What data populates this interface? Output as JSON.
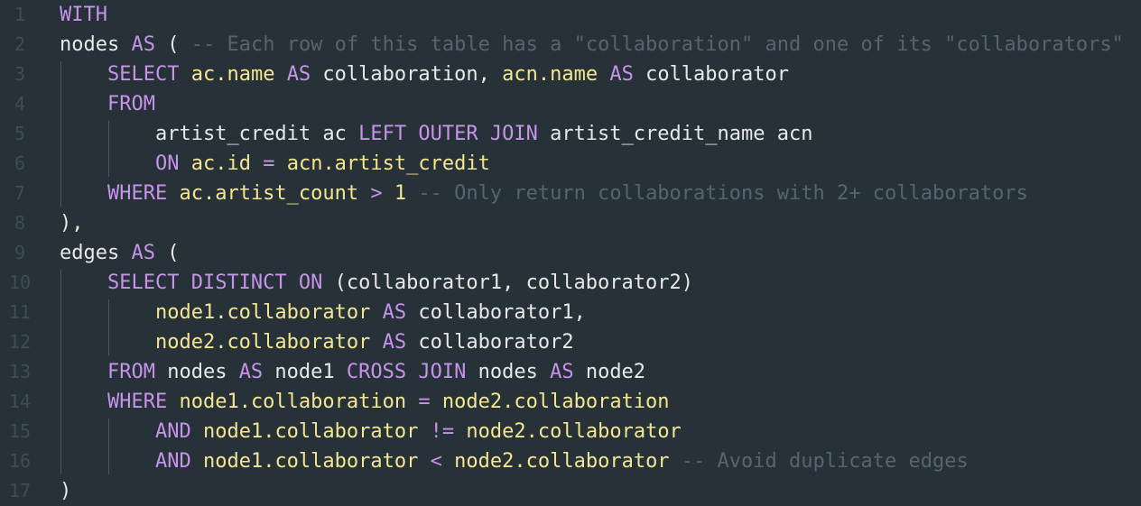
{
  "colors": {
    "background": "#263238",
    "keyword": "#c792ea",
    "identifier": "#f5e592",
    "plain": "#e8e8e8",
    "comment": "#55656f",
    "line_number": "#3f4d55"
  },
  "lines": [
    {
      "number": "1",
      "tokens": [
        {
          "t": "kw",
          "v": "WITH"
        }
      ]
    },
    {
      "number": "2",
      "tokens": [
        {
          "t": "pl",
          "v": "nodes "
        },
        {
          "t": "kw",
          "v": "AS"
        },
        {
          "t": "pl",
          "v": " ( "
        },
        {
          "t": "cm",
          "v": "-- Each row of this table has a \"collaboration\" and one of its \"collaborators\""
        }
      ]
    },
    {
      "number": "3",
      "tokens": [
        {
          "t": "pl",
          "v": "    "
        },
        {
          "t": "kw",
          "v": "SELECT"
        },
        {
          "t": "pl",
          "v": " "
        },
        {
          "t": "id",
          "v": "ac.name"
        },
        {
          "t": "pl",
          "v": " "
        },
        {
          "t": "kw",
          "v": "AS"
        },
        {
          "t": "pl",
          "v": " collaboration, "
        },
        {
          "t": "id",
          "v": "acn.name"
        },
        {
          "t": "pl",
          "v": " "
        },
        {
          "t": "kw",
          "v": "AS"
        },
        {
          "t": "pl",
          "v": " collaborator"
        }
      ]
    },
    {
      "number": "4",
      "tokens": [
        {
          "t": "pl",
          "v": "    "
        },
        {
          "t": "kw",
          "v": "FROM"
        }
      ]
    },
    {
      "number": "5",
      "tokens": [
        {
          "t": "pl",
          "v": "        artist_credit ac "
        },
        {
          "t": "kw",
          "v": "LEFT OUTER JOIN"
        },
        {
          "t": "pl",
          "v": " artist_credit_name acn"
        }
      ]
    },
    {
      "number": "6",
      "tokens": [
        {
          "t": "pl",
          "v": "        "
        },
        {
          "t": "kw",
          "v": "ON"
        },
        {
          "t": "pl",
          "v": " "
        },
        {
          "t": "id",
          "v": "ac.id"
        },
        {
          "t": "pl",
          "v": " "
        },
        {
          "t": "op",
          "v": "="
        },
        {
          "t": "pl",
          "v": " "
        },
        {
          "t": "id",
          "v": "acn.artist_credit"
        }
      ]
    },
    {
      "number": "7",
      "tokens": [
        {
          "t": "pl",
          "v": "    "
        },
        {
          "t": "kw",
          "v": "WHERE"
        },
        {
          "t": "pl",
          "v": " "
        },
        {
          "t": "id",
          "v": "ac.artist_count"
        },
        {
          "t": "pl",
          "v": " "
        },
        {
          "t": "op",
          "v": ">"
        },
        {
          "t": "pl",
          "v": " "
        },
        {
          "t": "num",
          "v": "1"
        },
        {
          "t": "pl",
          "v": " "
        },
        {
          "t": "cm",
          "v": "-- Only return collaborations with 2+ collaborators"
        }
      ]
    },
    {
      "number": "8",
      "tokens": [
        {
          "t": "pl",
          "v": "),"
        }
      ]
    },
    {
      "number": "9",
      "tokens": [
        {
          "t": "pl",
          "v": "edges "
        },
        {
          "t": "kw",
          "v": "AS"
        },
        {
          "t": "pl",
          "v": " ("
        }
      ]
    },
    {
      "number": "10",
      "tokens": [
        {
          "t": "pl",
          "v": "    "
        },
        {
          "t": "kw",
          "v": "SELECT DISTINCT ON"
        },
        {
          "t": "pl",
          "v": " (collaborator1, collaborator2)"
        }
      ]
    },
    {
      "number": "11",
      "tokens": [
        {
          "t": "pl",
          "v": "        "
        },
        {
          "t": "id",
          "v": "node1.collaborator"
        },
        {
          "t": "pl",
          "v": " "
        },
        {
          "t": "kw",
          "v": "AS"
        },
        {
          "t": "pl",
          "v": " collaborator1,"
        }
      ]
    },
    {
      "number": "12",
      "tokens": [
        {
          "t": "pl",
          "v": "        "
        },
        {
          "t": "id",
          "v": "node2.collaborator"
        },
        {
          "t": "pl",
          "v": " "
        },
        {
          "t": "kw",
          "v": "AS"
        },
        {
          "t": "pl",
          "v": " collaborator2"
        }
      ]
    },
    {
      "number": "13",
      "tokens": [
        {
          "t": "pl",
          "v": "    "
        },
        {
          "t": "kw",
          "v": "FROM"
        },
        {
          "t": "pl",
          "v": " nodes "
        },
        {
          "t": "kw",
          "v": "AS"
        },
        {
          "t": "pl",
          "v": " node1 "
        },
        {
          "t": "kw",
          "v": "CROSS JOIN"
        },
        {
          "t": "pl",
          "v": " nodes "
        },
        {
          "t": "kw",
          "v": "AS"
        },
        {
          "t": "pl",
          "v": " node2"
        }
      ]
    },
    {
      "number": "14",
      "tokens": [
        {
          "t": "pl",
          "v": "    "
        },
        {
          "t": "kw",
          "v": "WHERE"
        },
        {
          "t": "pl",
          "v": " "
        },
        {
          "t": "id",
          "v": "node1.collaboration"
        },
        {
          "t": "pl",
          "v": " "
        },
        {
          "t": "op",
          "v": "="
        },
        {
          "t": "pl",
          "v": " "
        },
        {
          "t": "id",
          "v": "node2.collaboration"
        }
      ]
    },
    {
      "number": "15",
      "tokens": [
        {
          "t": "pl",
          "v": "        "
        },
        {
          "t": "kw",
          "v": "AND"
        },
        {
          "t": "pl",
          "v": " "
        },
        {
          "t": "id",
          "v": "node1.collaborator"
        },
        {
          "t": "pl",
          "v": " "
        },
        {
          "t": "op",
          "v": "!="
        },
        {
          "t": "pl",
          "v": " "
        },
        {
          "t": "id",
          "v": "node2.collaborator"
        }
      ]
    },
    {
      "number": "16",
      "tokens": [
        {
          "t": "pl",
          "v": "        "
        },
        {
          "t": "kw",
          "v": "AND"
        },
        {
          "t": "pl",
          "v": " "
        },
        {
          "t": "id",
          "v": "node1.collaborator"
        },
        {
          "t": "pl",
          "v": " "
        },
        {
          "t": "op",
          "v": "<"
        },
        {
          "t": "pl",
          "v": " "
        },
        {
          "t": "id",
          "v": "node2.collaborator"
        },
        {
          "t": "pl",
          "v": " "
        },
        {
          "t": "cm",
          "v": "-- Avoid duplicate edges"
        }
      ]
    },
    {
      "number": "17",
      "tokens": [
        {
          "t": "pl",
          "v": ")"
        }
      ]
    }
  ]
}
